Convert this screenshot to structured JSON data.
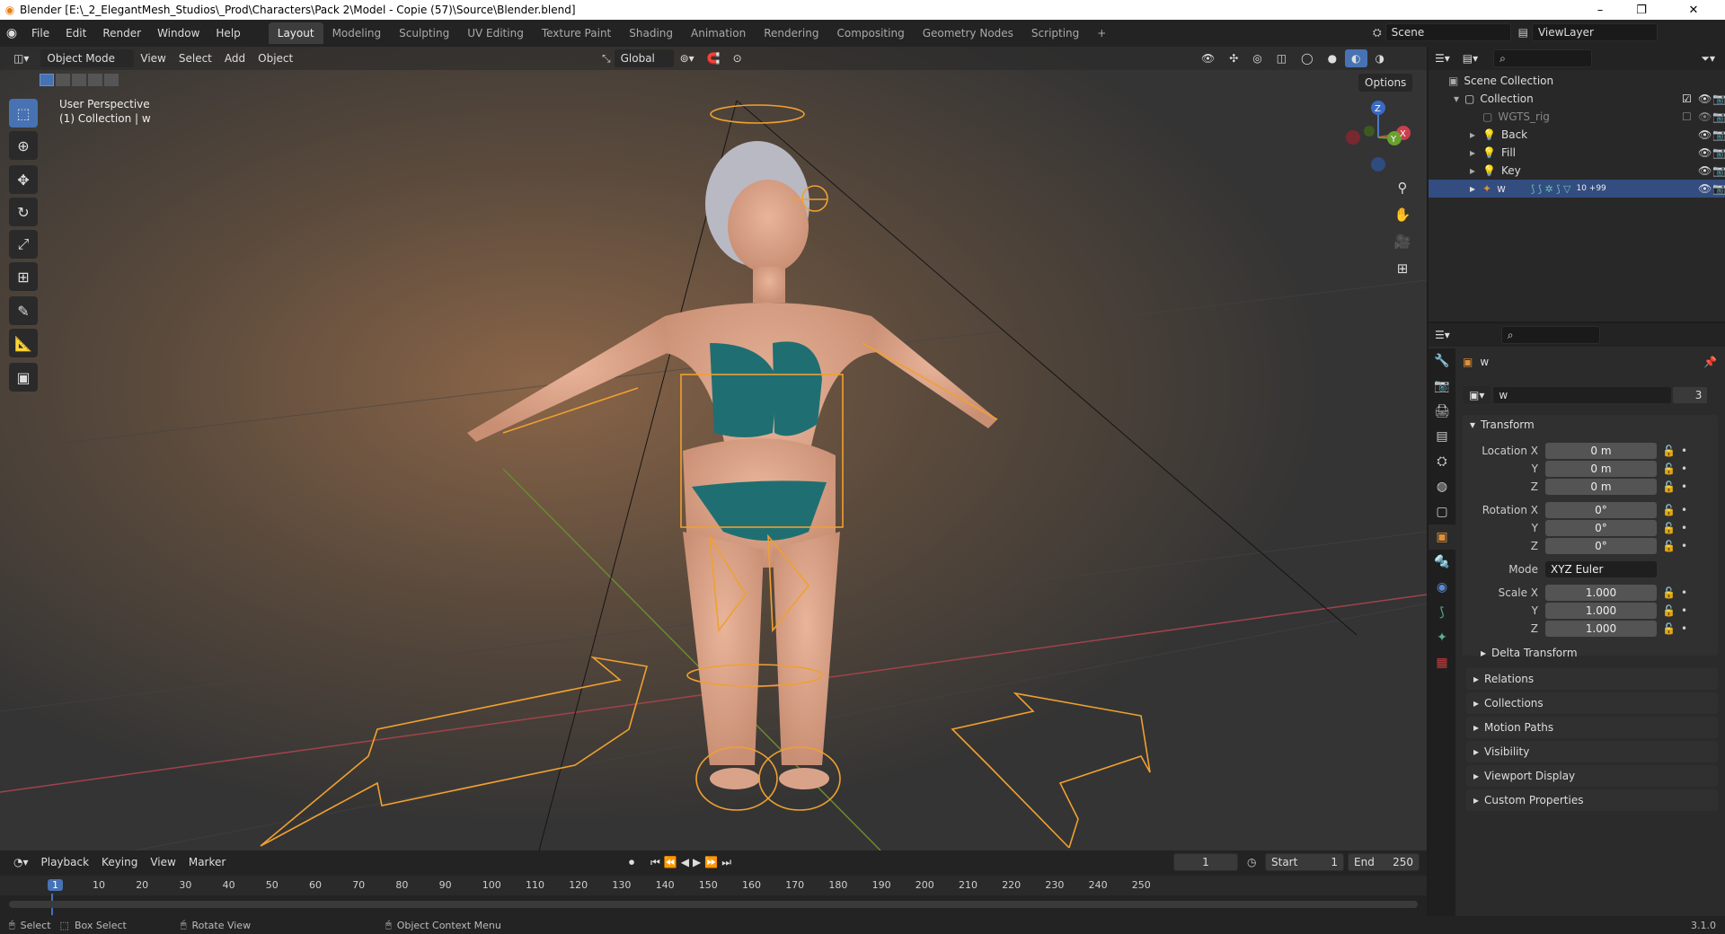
{
  "window": {
    "title": "Blender [E:\\_2_ElegantMesh_Studios\\_Prod\\Characters\\Pack 2\\Model - Copie (57)\\Source\\Blender.blend]",
    "minimize": "–",
    "maximize": "❐",
    "close": "✕"
  },
  "menus": [
    "File",
    "Edit",
    "Render",
    "Window",
    "Help"
  ],
  "workspaces": [
    "Layout",
    "Modeling",
    "Sculpting",
    "UV Editing",
    "Texture Paint",
    "Shading",
    "Animation",
    "Rendering",
    "Compositing",
    "Geometry Nodes",
    "Scripting"
  ],
  "active_workspace": "Layout",
  "add_workspace": "+",
  "scene": {
    "label": "Scene",
    "viewlayer": "ViewLayer"
  },
  "viewport_header": {
    "mode": "Object Mode",
    "menus": [
      "View",
      "Select",
      "Add",
      "Object"
    ],
    "orientation": "Global",
    "options": "Options"
  },
  "viewport_overlay": {
    "line1": "User Perspective",
    "line2": "(1) Collection | w"
  },
  "gizmo": {
    "x": "X",
    "y": "Y",
    "z": "Z"
  },
  "outliner": {
    "search_placeholder": "",
    "rows": [
      {
        "label": "Scene Collection",
        "indent": 0
      },
      {
        "label": "Collection",
        "indent": 1
      },
      {
        "label": "WGTS_rig",
        "indent": 2
      },
      {
        "label": "Back",
        "indent": 2
      },
      {
        "label": "Fill",
        "indent": 2
      },
      {
        "label": "Key",
        "indent": 2
      },
      {
        "label": "w",
        "indent": 2
      }
    ],
    "w_extra": "10 +99"
  },
  "properties": {
    "object_name": "w",
    "datablock_name": "w",
    "user_count": "3",
    "transform": {
      "header": "Transform",
      "location_label": "Location X",
      "location": [
        "0 m",
        "0 m",
        "0 m"
      ],
      "rotation_label": "Rotation X",
      "rotation": [
        "0°",
        "0°",
        "0°"
      ],
      "mode_label": "Mode",
      "mode_value": "XYZ Euler",
      "scale_label": "Scale X",
      "scale": [
        "1.000",
        "1.000",
        "1.000"
      ],
      "y_label": "Y",
      "z_label": "Z"
    },
    "delta_transform": "Delta Transform",
    "panels": [
      "Relations",
      "Collections",
      "Motion Paths",
      "Visibility",
      "Viewport Display",
      "Custom Properties"
    ]
  },
  "timeline": {
    "menus": [
      "Playback",
      "Keying",
      "View",
      "Marker"
    ],
    "current_frame": "1",
    "start_label": "Start",
    "start": "1",
    "end_label": "End",
    "end": "250",
    "ruler": [
      "1",
      "10",
      "20",
      "30",
      "40",
      "50",
      "60",
      "70",
      "80",
      "90",
      "100",
      "110",
      "120",
      "130",
      "140",
      "150",
      "160",
      "170",
      "180",
      "190",
      "200",
      "210",
      "220",
      "230",
      "240",
      "250"
    ]
  },
  "statusbar": {
    "select": "Select",
    "box_select": "Box Select",
    "rotate_view": "Rotate View",
    "context_menu": "Object Context Menu",
    "version": "3.1.0"
  },
  "colors": {
    "accent": "#4772b3",
    "rig": "#f0a030",
    "selected_row": "#334d80"
  }
}
